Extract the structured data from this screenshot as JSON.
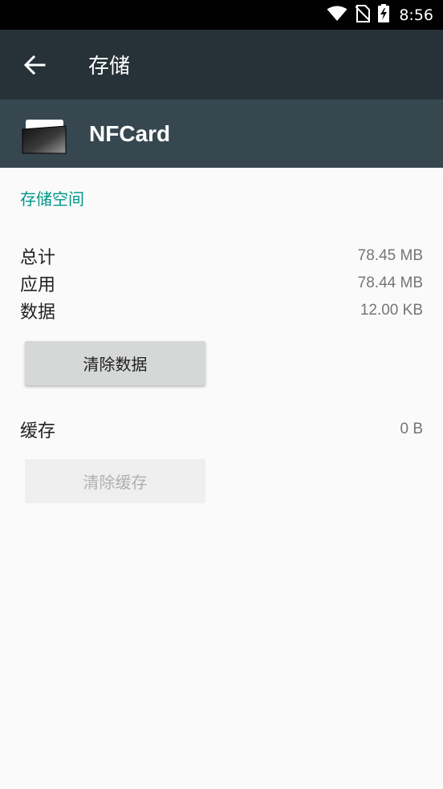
{
  "status_bar": {
    "time": "8:56",
    "icons": [
      "wifi-icon",
      "no-sim-icon",
      "battery-charging-icon"
    ]
  },
  "app_bar": {
    "back_icon": "arrow-back-icon",
    "title": "存储"
  },
  "app_header": {
    "app_icon": "nfcard-app-icon",
    "app_name": "NFCard"
  },
  "storage": {
    "section_title": "存储空间",
    "rows": [
      {
        "label": "总计",
        "value": "78.45 MB"
      },
      {
        "label": "应用",
        "value": "78.44 MB"
      },
      {
        "label": "数据",
        "value": "12.00 KB"
      }
    ],
    "clear_data_label": "清除数据"
  },
  "cache": {
    "label": "缓存",
    "value": "0 B",
    "clear_cache_label": "清除缓存"
  },
  "colors": {
    "status_bar": "#000000",
    "app_bar": "#263238",
    "app_header": "#37474f",
    "accent": "#009688",
    "background": "#fafafa"
  }
}
